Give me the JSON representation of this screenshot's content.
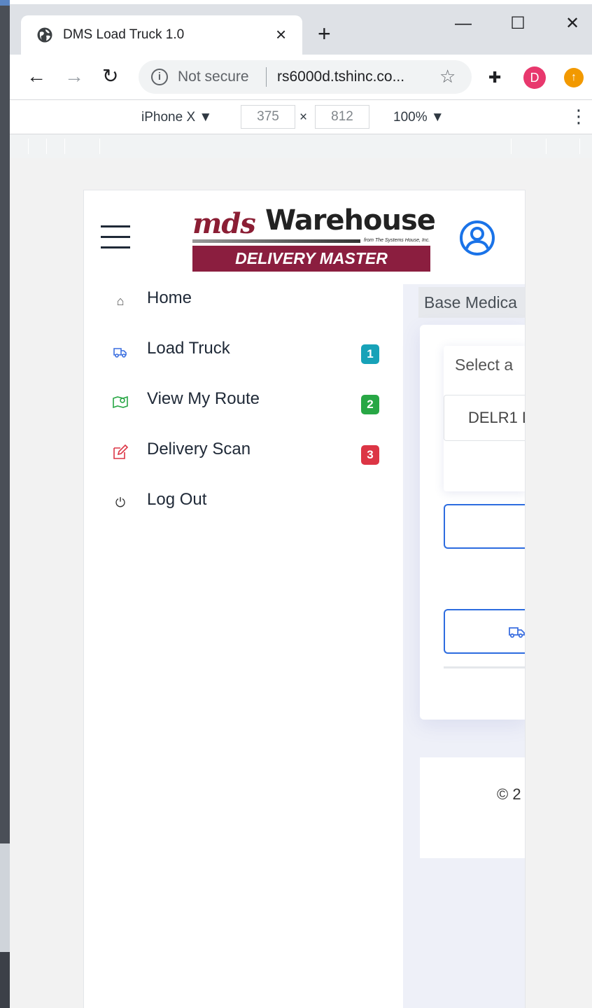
{
  "browser": {
    "tab_title": "DMS Load Truck 1.0",
    "tab_close": "×",
    "new_tab": "+",
    "window_controls": {
      "minimize": "—",
      "maximize": "☐",
      "close": "✕"
    },
    "nav": {
      "back": "←",
      "forward": "→",
      "reload": "↻"
    },
    "security_label": "Not secure",
    "info_glyph": "i",
    "url": "rs6000d.tshinc.co...",
    "star": "☆",
    "extensions_glyph": "✚",
    "profile_initial": "D",
    "update_glyph": "↑"
  },
  "devtools": {
    "device": "iPhone X ▼",
    "width": "375",
    "times": "×",
    "height": "812",
    "zoom": "100% ▼",
    "more": "⋮"
  },
  "app": {
    "logo": {
      "mds": "mds",
      "warehouse": "Warehouse",
      "from": "from The Systems House, Inc.",
      "band": "DELIVERY MASTER"
    },
    "sidebar": {
      "items": [
        {
          "label": "Home",
          "icon": "home-icon",
          "glyph": "⌂",
          "color": "#555555"
        },
        {
          "label": "Load Truck",
          "icon": "truck-icon",
          "badge": "1",
          "badge_color": "#17a2b8",
          "color": "#3b6fe0"
        },
        {
          "label": "View My Route",
          "icon": "map-icon",
          "badge": "2",
          "badge_color": "#28a745",
          "color": "#28a745"
        },
        {
          "label": "Delivery Scan",
          "icon": "edit-icon",
          "badge": "3",
          "badge_color": "#dc3545",
          "color": "#dc3545"
        },
        {
          "label": "Log Out",
          "icon": "power-icon",
          "glyph": "⏻",
          "color": "#333333"
        }
      ]
    },
    "content": {
      "breadcrumb": "Base Medica",
      "select_label": "Select a",
      "option_value": "DELR1 D",
      "footer": "© 2"
    }
  }
}
